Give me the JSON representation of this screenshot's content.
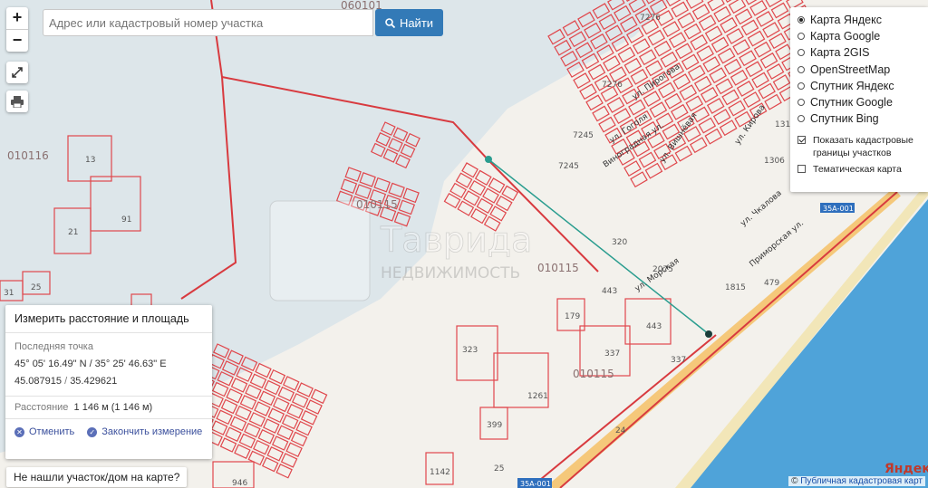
{
  "search": {
    "placeholder": "Адрес или кадастровый номер участка",
    "button_label": "Найти"
  },
  "zoom": {
    "in_label": "+",
    "out_label": "−"
  },
  "layers": {
    "base": [
      {
        "label": "Карта Яндекс",
        "selected": true
      },
      {
        "label": "Карта Google",
        "selected": false
      },
      {
        "label": "Карта 2GIS",
        "selected": false
      },
      {
        "label": "OpenStreetMap",
        "selected": false
      },
      {
        "label": "Спутник Яндекс",
        "selected": false
      },
      {
        "label": "Спутник Google",
        "selected": false
      },
      {
        "label": "Спутник Bing",
        "selected": false
      }
    ],
    "show_cadastral": {
      "label": "Показать кадастровые границы участков",
      "checked": true
    },
    "thematic": {
      "label": "Тематическая карта",
      "checked": false
    }
  },
  "measure": {
    "title": "Измерить расстояние и площадь",
    "last_point_label": "Последняя точка",
    "coords_dms": "45° 05' 16.49\" N / 35° 25' 46.63\" E",
    "coords_dec_lat": "45.087915",
    "coords_dec_sep": "/",
    "coords_dec_lon": "35.429621",
    "distance_label": "Расстояние",
    "distance_value": "1 146 м (1 146 м)",
    "cancel_label": "Отменить",
    "finish_label": "Закончить измерение"
  },
  "not_found_label": "Не нашли участок/дом на карте?",
  "attribution": {
    "prefix": "©",
    "link": "Публичная кадастровая карт"
  },
  "map": {
    "quarter_labels": [
      "060101",
      "010116",
      "010115",
      "010115",
      "010115"
    ],
    "plot_numbers": [
      "13",
      "91",
      "21",
      "31",
      "25",
      "323",
      "1261",
      "399",
      "179",
      "337",
      "443",
      "443",
      "25",
      "946",
      "1142",
      "7276",
      "7276",
      "7245",
      "7245",
      "1315",
      "1306",
      "320",
      "2075",
      "1815",
      "479",
      "337",
      "24"
    ],
    "streets": [
      "ул. Гоголя",
      "ул. Пирогова",
      "Виноградная ул.",
      "ул. Вишнёвая",
      "ул. Кирова",
      "ул. Чкалова",
      "ул. Морская",
      "Приморская ул."
    ],
    "road_labels": [
      "35А-001",
      "35А-001"
    ],
    "watermark_title": "Таврида",
    "watermark_subtitle": "НЕДВИЖИМОСТЬ",
    "yandex_logo": "Яндекс"
  },
  "colors": {
    "accent": "#337ab7",
    "cadastral": "#e0474c",
    "water": "#dfe9ee",
    "sea": "#4fa3d9",
    "route": "#2a9d8f"
  }
}
